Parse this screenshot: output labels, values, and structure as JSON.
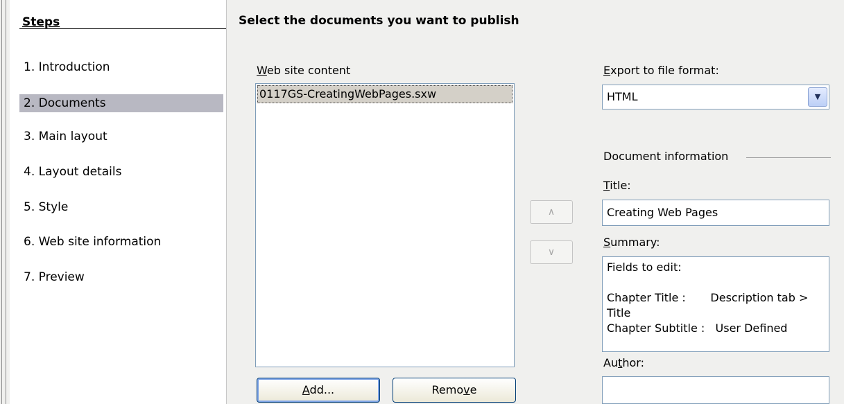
{
  "steps": {
    "title": "Steps",
    "items": [
      {
        "label": "1.  Introduction",
        "active": false
      },
      {
        "label": "2.  Documents",
        "active": true
      },
      {
        "label": "3.  Main layout",
        "active": false
      },
      {
        "label": "4.  Layout details",
        "active": false
      },
      {
        "label": "5.  Style",
        "active": false
      },
      {
        "label": "6.  Web site information",
        "active": false
      },
      {
        "label": "7.  Preview",
        "active": false
      }
    ]
  },
  "main": {
    "heading": "Select the documents you want to publish",
    "content_label_key": "W",
    "content_label_rest": "eb site content",
    "documents": [
      "0117GS-CreatingWebPages.sxw"
    ],
    "add_key": "A",
    "add_rest": "dd...",
    "remove_pre": "Remo",
    "remove_key": "v",
    "remove_post": "e",
    "move_up_icon": "up-arrow-icon",
    "move_up_glyph": "∧",
    "move_down_icon": "down-arrow-icon",
    "move_down_glyph": "∨"
  },
  "export": {
    "label_key": "E",
    "label_rest": "xport to file format:",
    "value": "HTML",
    "dropdown_glyph": "▼"
  },
  "doc_info": {
    "section_label": "Document information",
    "title_label_key": "T",
    "title_label_rest": "itle:",
    "title_value": "Creating Web Pages",
    "summary_label_key": "S",
    "summary_label_rest": "ummary:",
    "summary_value": "Fields to edit:\n\nChapter Title :       Description tab > Title\nChapter Subtitle :   User Defined",
    "author_label_pre": "Au",
    "author_label_key": "t",
    "author_label_post": "hor:",
    "author_value": ""
  },
  "colors": {
    "active_step_bg": "#b8b8c2",
    "selected_item_bg": "#d4d0c8",
    "field_border": "#7f9db9"
  }
}
